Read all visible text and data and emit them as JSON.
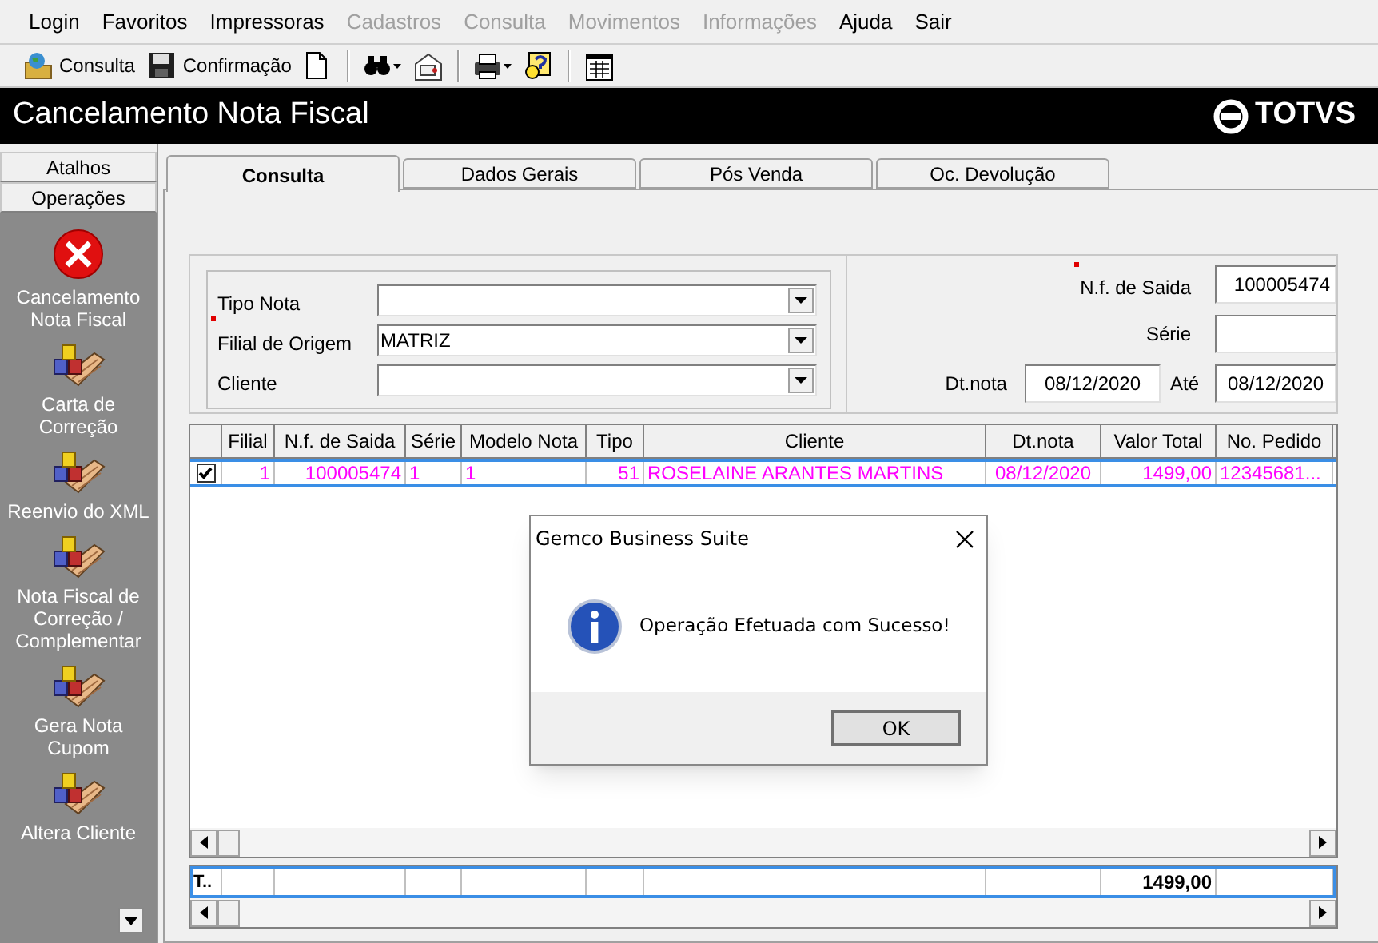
{
  "menu": [
    {
      "label": "Login",
      "disabled": false
    },
    {
      "label": "Favoritos",
      "disabled": false
    },
    {
      "label": "Impressoras",
      "disabled": false
    },
    {
      "label": "Cadastros",
      "disabled": true
    },
    {
      "label": "Consulta",
      "disabled": true
    },
    {
      "label": "Movimentos",
      "disabled": true
    },
    {
      "label": "Informações",
      "disabled": true
    },
    {
      "label": "Ajuda",
      "disabled": false
    },
    {
      "label": "Sair",
      "disabled": false
    }
  ],
  "toolbar": [
    {
      "kind": "consult",
      "label": "Consulta"
    },
    {
      "kind": "save",
      "label": "Confirmação"
    },
    {
      "kind": "new"
    },
    {
      "kind": "sep"
    },
    {
      "kind": "find"
    },
    {
      "kind": "mail"
    },
    {
      "kind": "sep"
    },
    {
      "kind": "print"
    },
    {
      "kind": "help"
    },
    {
      "kind": "sep"
    },
    {
      "kind": "calendar"
    }
  ],
  "window": {
    "title": "Cancelamento Nota Fiscal",
    "logo": "TOTVS"
  },
  "sidebar": {
    "tabs": [
      {
        "label": "Atalhos"
      },
      {
        "label": "Operações"
      }
    ],
    "items": [
      {
        "kind": "cancel",
        "label": "Cancelamento Nota Fiscal"
      },
      {
        "kind": "blocks",
        "label": "Carta de Correção"
      },
      {
        "kind": "blocks",
        "label": "Reenvio do XML"
      },
      {
        "kind": "blocks",
        "label": "Nota Fiscal de Correção / Complementar"
      },
      {
        "kind": "blocks",
        "label": "Gera Nota Cupom"
      },
      {
        "kind": "blocks",
        "label": "Altera Cliente"
      }
    ]
  },
  "tabs": [
    {
      "label": "Consulta",
      "selected": true
    },
    {
      "label": "Dados Gerais",
      "selected": false
    },
    {
      "label": "Pós Venda",
      "selected": false
    },
    {
      "label": "Oc. Devolução",
      "selected": false
    }
  ],
  "filters_left": [
    {
      "label": "Tipo Nota",
      "required": false
    },
    {
      "label": "Filial de Origem",
      "value": "MATRIZ",
      "required": true
    },
    {
      "label": "Cliente",
      "required": false
    }
  ],
  "filters_right": {
    "nf": {
      "label": "N.f. de Saida",
      "value": "100005474",
      "required": true
    },
    "serie": {
      "label": "Série",
      "required": false
    },
    "date_from": {
      "label": "Dt.nota",
      "value": "08/12/2020"
    },
    "date_to": {
      "label": "Até",
      "value": "08/12/2020"
    }
  },
  "table": {
    "columns": [
      {
        "label": "Filial"
      },
      {
        "label": "N.f. de Saida"
      },
      {
        "label": "Série"
      },
      {
        "label": "Modelo Nota"
      },
      {
        "label": "Tipo"
      },
      {
        "label": "Cliente"
      },
      {
        "label": "Dt.nota"
      },
      {
        "label": "Valor Total"
      },
      {
        "label": "No. Pedido"
      }
    ],
    "rows": [
      {
        "checked": true,
        "selected": true,
        "cells": [
          "1",
          "100005474",
          "1",
          "1",
          "51",
          "ROSELAINE ARANTES MARTINS",
          "08/12/2020",
          "1499,00",
          "12345681..."
        ]
      }
    ],
    "totals": {
      "label": "T..",
      "cells": [
        "",
        "",
        "",
        "",
        "",
        "",
        "",
        "1499,00",
        ""
      ]
    }
  },
  "dialog": {
    "title": "Gemco Business Suite",
    "message": "Operação Efetuada com Sucesso!",
    "button": "OK"
  }
}
